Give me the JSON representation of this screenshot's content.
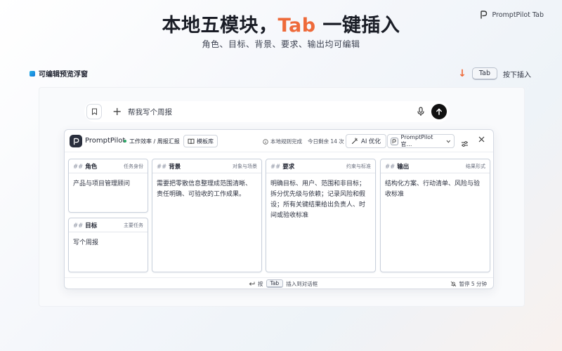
{
  "brand_tag": "PromptPilot Tab",
  "hero": {
    "title_before": "本地五模块，",
    "title_accent": "Tab",
    "title_after": " 一键插入",
    "subtitle": "角色、目标、背景、要求、输出均可编辑"
  },
  "preview_label": "可编辑预览浮窗",
  "hint": {
    "arrow": "↓",
    "key": "Tab",
    "text": "按下插入"
  },
  "chatbar": {
    "input_value": "帮我写个周报"
  },
  "panel": {
    "app_name": "PromptPilot",
    "path": "工作效率 / 周报汇报",
    "template_button": "模板库",
    "status": "本地规则完成",
    "remaining": "今日剩余 14 次",
    "ai_button": "AI 优化",
    "model": "PromptPilot 官…",
    "cards": {
      "role": {
        "title": "角色",
        "hint": "任务身份",
        "content": "产品与项目管理顾问"
      },
      "goal": {
        "title": "目标",
        "hint": "主要任务",
        "content": "写个周报"
      },
      "background": {
        "title": "背景",
        "hint": "对象与场景",
        "content": "需要把零散信息整理成范围清晰、责任明确、可验收的工作成果。"
      },
      "requirements": {
        "title": "要求",
        "hint": "约束与标准",
        "content": "明确目标、用户、范围和非目标；拆分优先级与依赖；记录风险和假设；所有关键结果给出负责人、时间或验收标准"
      },
      "output": {
        "title": "输出",
        "hint": "结果形式",
        "content": "结构化方案、行动清单、风险与验收标准"
      }
    },
    "footer": {
      "prefix": "按",
      "key": "Tab",
      "suffix": "插入到对话框",
      "pause": "暂停 5 分钟"
    }
  },
  "colors": {
    "accent": "#ee6a3a",
    "status_dot": "#2aa866"
  }
}
